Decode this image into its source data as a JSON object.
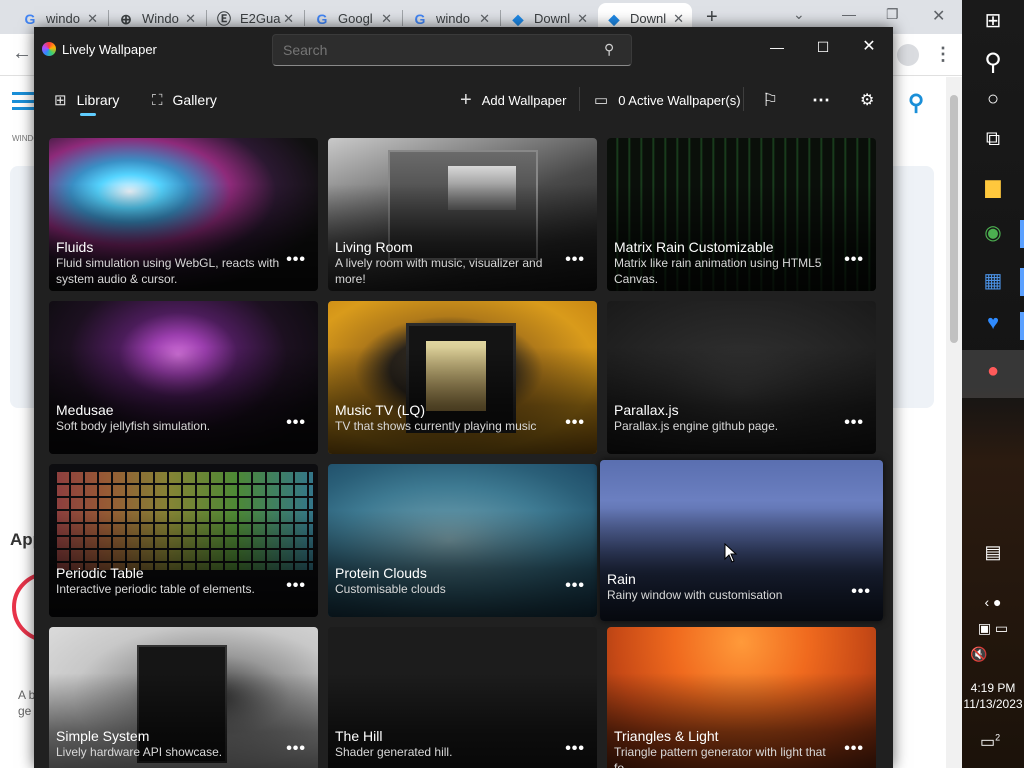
{
  "browser": {
    "tabs": [
      {
        "label": "windo",
        "icon": "google-icon"
      },
      {
        "label": "Windo",
        "icon": "globe-icon"
      },
      {
        "label": "E2Gua",
        "icon": "e2-icon"
      },
      {
        "label": "Googl",
        "icon": "google-icon"
      },
      {
        "label": "windo",
        "icon": "google-icon"
      },
      {
        "label": "Downl",
        "icon": "download-site-icon"
      },
      {
        "label": "Downl",
        "icon": "download-site-icon"
      }
    ],
    "behind": {
      "app_heading": "App",
      "snippet": "A b",
      "snippet2": "ge",
      "small_label": "WINDO"
    }
  },
  "lively": {
    "app_title": "Lively Wallpaper",
    "search_placeholder": "Search",
    "nav": {
      "library": "Library",
      "gallery": "Gallery",
      "add_wallpaper": "Add Wallpaper",
      "active_wallpapers": "0 Active Wallpaper(s)"
    },
    "more_symbol": "...",
    "cards": [
      {
        "title": "Fluids",
        "desc": "Fluid simulation using WebGL, reacts with system audio & cursor."
      },
      {
        "title": "Living Room",
        "desc": "A lively room with music, visualizer and more!"
      },
      {
        "title": "Matrix Rain Customizable",
        "desc": "Matrix like rain animation using HTML5 Canvas."
      },
      {
        "title": "Medusae",
        "desc": "Soft body jellyfish simulation."
      },
      {
        "title": "Music TV (LQ)",
        "desc": "TV that shows currently playing music"
      },
      {
        "title": "Parallax.js",
        "desc": "Parallax.js engine github page."
      },
      {
        "title": "Periodic Table",
        "desc": "Interactive periodic table of elements."
      },
      {
        "title": "Protein Clouds",
        "desc": "Customisable clouds"
      },
      {
        "title": "Rain",
        "desc": "Rainy window with customisation"
      },
      {
        "title": "Simple System",
        "desc": "Lively hardware API showcase."
      },
      {
        "title": "The Hill",
        "desc": "Shader generated hill."
      },
      {
        "title": "Triangles & Light",
        "desc": "Triangle pattern generator with light that fo..."
      }
    ]
  },
  "taskbar": {
    "time": "4:19 PM",
    "date": "11/13/2023",
    "notification_count": "2"
  },
  "colors": {
    "accent": "#60cdff",
    "window_bg": "#202020",
    "browser_accent": "#1a8fd8"
  }
}
